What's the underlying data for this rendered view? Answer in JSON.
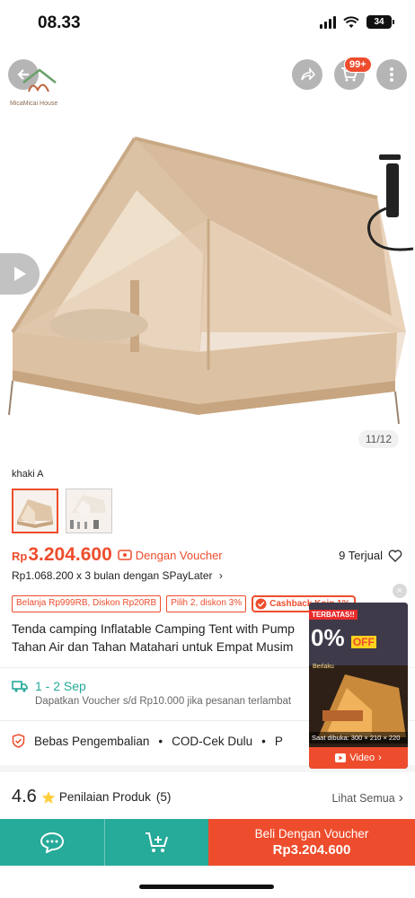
{
  "status_bar": {
    "time": "08.33",
    "battery": "34"
  },
  "header": {
    "logo_text": "MicaMicai House",
    "cart_count": "99+"
  },
  "gallery": {
    "counter": "11/12"
  },
  "variant": {
    "label": "khaki A"
  },
  "price": {
    "currency": "Rp",
    "value": "3.204.600",
    "voucher_label": "Dengan Voucher",
    "sold": "9 Terjual",
    "installment": "Rp1.068.200 x 3 bulan dengan SPayLater",
    "installment_chevron": "›"
  },
  "promos": {
    "tag1": "Belanja Rp999RB, Diskon Rp20RB",
    "tag2": "Pilih 2, diskon 3%",
    "tag3": "Cashback Koin 1%"
  },
  "product": {
    "title_line1": "Tenda camping  Inflatable Camping Tent with Pump",
    "title_line2": "Tahan Air dan Tahan Matahari untuk Empat Musim"
  },
  "shipping": {
    "days": "1 - 2 Sep",
    "subtext": "Dapatkan Voucher s/d Rp10.000 jika pesanan terlambat"
  },
  "benefits": {
    "item1": "Bebas Pengembalian",
    "item2": "COD-Cek Dulu",
    "item3": "P",
    "separator": "•"
  },
  "rating": {
    "value": "4.6",
    "label": "Penilaian Produk",
    "count": "(5)",
    "see_all": "Lihat Semua",
    "see_all_chevron": "›"
  },
  "bottom_bar": {
    "buy_line1": "Beli Dengan Voucher",
    "buy_line2": "Rp3.204.600"
  },
  "video_popup": {
    "close": "×",
    "badge": "TERBATAS!!",
    "off_big": "0%",
    "off_small": "OFF",
    "small_text": "Berlaku",
    "caption": "Saat dibuka: 300 × 210 × 220",
    "button": "Video",
    "button_chevron": "›"
  },
  "colors": {
    "accent": "#ee4d2d",
    "teal": "#26aa99"
  }
}
